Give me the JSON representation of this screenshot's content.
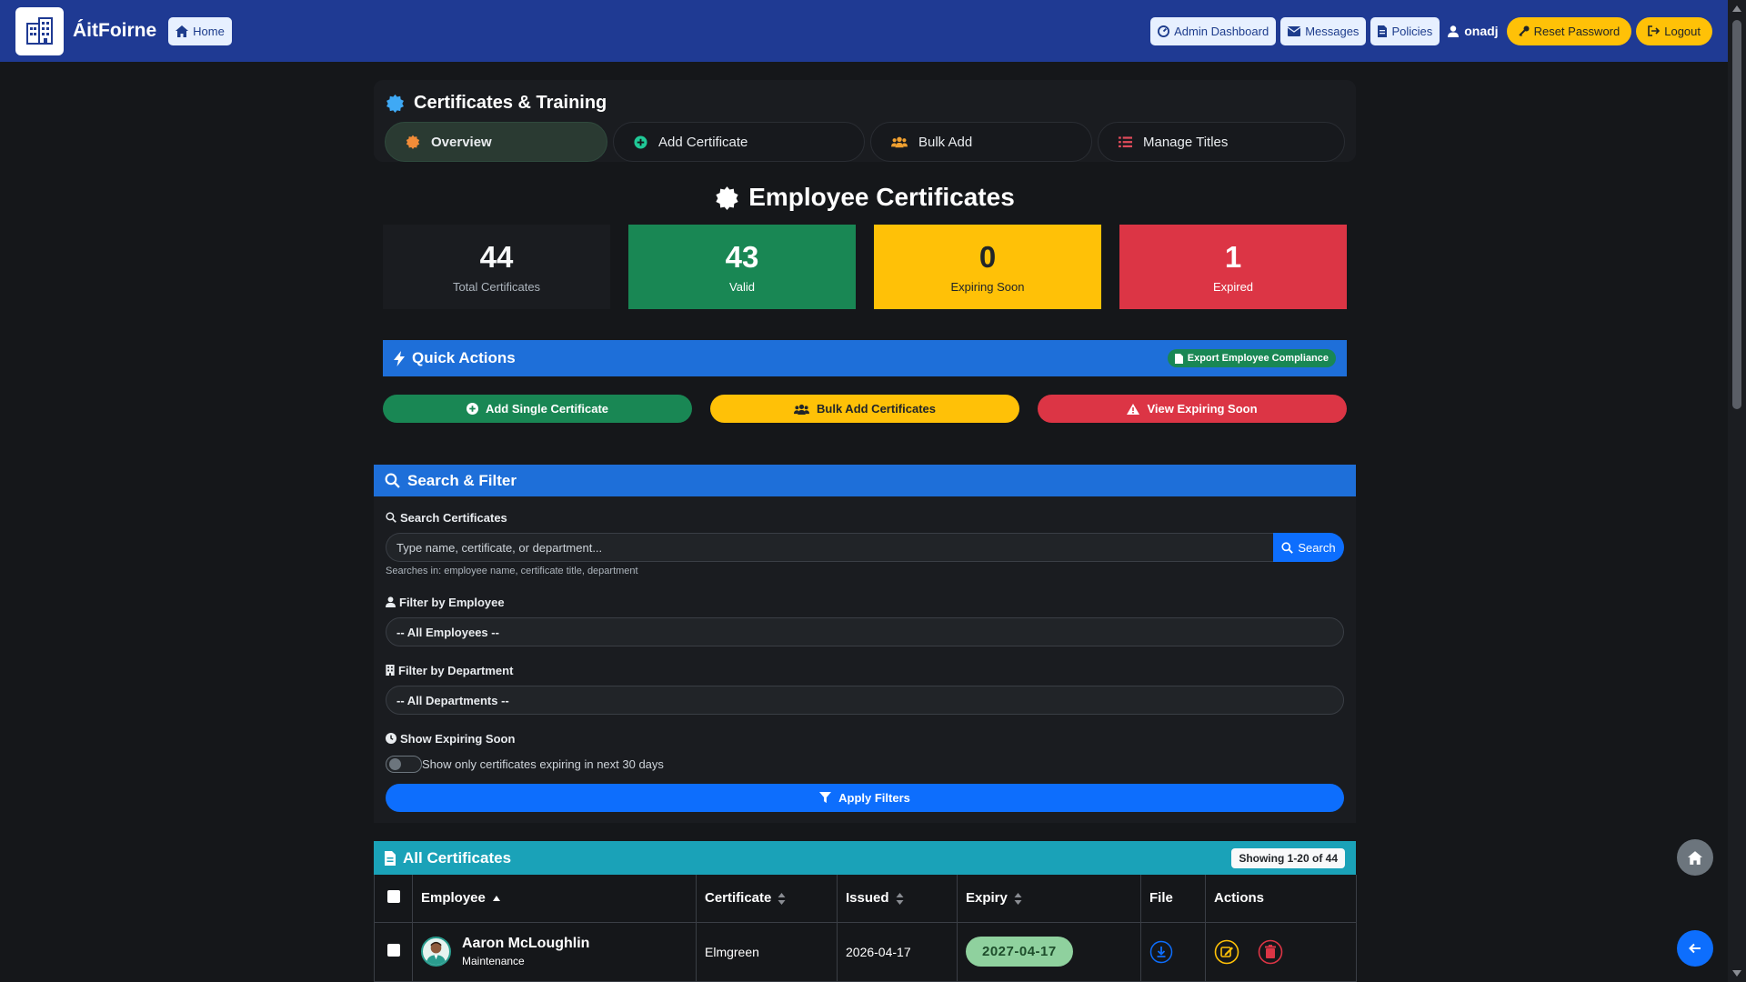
{
  "app": {
    "brand": "ÁitFoirne",
    "home_label": "Home"
  },
  "nav": {
    "admin_dashboard": "Admin Dashboard",
    "messages": "Messages",
    "policies": "Policies",
    "username": "onadj",
    "reset_password": "Reset Password",
    "logout": "Logout"
  },
  "page": {
    "title": "Certificates & Training",
    "tabs": [
      {
        "label": "Overview",
        "icon": "certificate-icon",
        "active": true
      },
      {
        "label": "Add Certificate",
        "icon": "plus-circle-icon"
      },
      {
        "label": "Bulk Add",
        "icon": "users-icon"
      },
      {
        "label": "Manage Titles",
        "icon": "list-icon"
      }
    ],
    "section_title": "Employee Certificates"
  },
  "stats": {
    "total": {
      "value": "44",
      "label": "Total Certificates"
    },
    "valid": {
      "value": "43",
      "label": "Valid"
    },
    "expiring": {
      "value": "0",
      "label": "Expiring Soon"
    },
    "expired": {
      "value": "1",
      "label": "Expired"
    }
  },
  "quick_actions": {
    "title": "Quick Actions",
    "export": "Export Employee Compliance",
    "add_single": "Add Single Certificate",
    "bulk_add": "Bulk Add Certificates",
    "view_expiring": "View Expiring Soon"
  },
  "search_filter": {
    "title": "Search & Filter",
    "search_label": "Search Certificates",
    "search_placeholder": "Type name, certificate, or department...",
    "search_button": "Search",
    "search_hint": "Searches in: employee name, certificate title, department",
    "employee_label": "Filter by Employee",
    "employee_value": "-- All Employees --",
    "department_label": "Filter by Department",
    "department_value": "-- All Departments --",
    "expiring_label": "Show Expiring Soon",
    "expiring_toggle_text": "Show only certificates expiring in next 30 days",
    "apply_button": "Apply Filters"
  },
  "certificates": {
    "title": "All Certificates",
    "showing": "Showing 1-20 of 44",
    "columns": {
      "employee": "Employee",
      "certificate": "Certificate",
      "issued": "Issued",
      "expiry": "Expiry",
      "file": "File",
      "actions": "Actions"
    },
    "rows": [
      {
        "name": "Aaron McLoughlin",
        "department": "Maintenance",
        "certificate": "Elmgreen",
        "issued": "2026-04-17",
        "expiry": "2027-04-17"
      }
    ]
  },
  "colors": {
    "navbar": "#1f3a93",
    "primary": "#0d6efd",
    "success": "#198754",
    "warning": "#ffc107",
    "danger": "#dc3545",
    "info": "#1aa2b8"
  }
}
